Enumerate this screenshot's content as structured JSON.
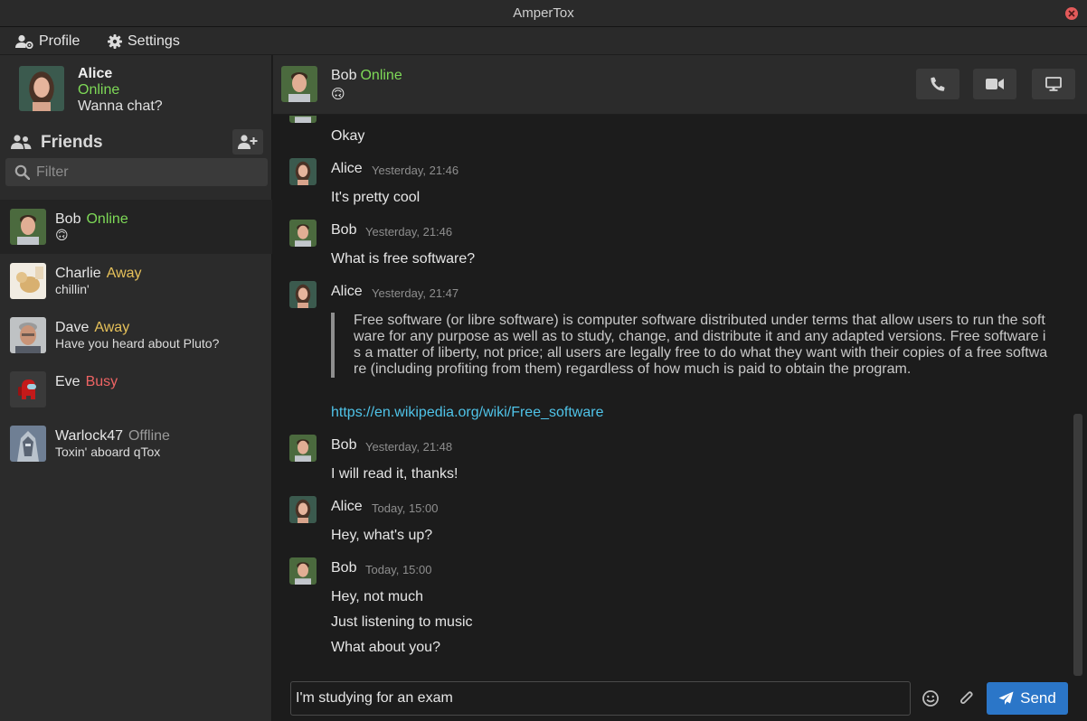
{
  "window": {
    "title": "AmperTox"
  },
  "menu": {
    "profile_label": "Profile",
    "settings_label": "Settings"
  },
  "self": {
    "name": "Alice",
    "status": "Online",
    "status_message": "Wanna chat?"
  },
  "friends_panel": {
    "title": "Friends",
    "filter_placeholder": "Filter"
  },
  "friends": [
    {
      "name": "Bob",
      "status": "Online",
      "message": "🙃"
    },
    {
      "name": "Charlie",
      "status": "Away",
      "message": "chillin'"
    },
    {
      "name": "Dave",
      "status": "Away",
      "message": "Have you heard about Pluto?"
    },
    {
      "name": "Eve",
      "status": "Busy",
      "message": ""
    },
    {
      "name": "Warlock47",
      "status": "Offline",
      "message": "Toxin' aboard qTox"
    }
  ],
  "chat": {
    "contact_name": "Bob",
    "contact_status": "Online",
    "contact_message": "🙃",
    "partial_first_line": "Okay",
    "messages": [
      {
        "author": "Alice",
        "time": "Yesterday, 21:46",
        "lines": [
          "It's pretty cool"
        ]
      },
      {
        "author": "Bob",
        "time": "Yesterday, 21:46",
        "lines": [
          "What is free software?"
        ]
      },
      {
        "author": "Alice",
        "time": "Yesterday, 21:47",
        "quote": "Free software (or libre software) is computer software distributed under terms that allow users to run the software for any purpose as well as to study, change, and distribute it and any adapted versions. Free software is a matter of liberty, not price; all users are legally free to do what they want with their copies of a free software (including profiting from them) regardless of how much is paid to obtain the program.",
        "link": "https://en.wikipedia.org/wiki/Free_software"
      },
      {
        "author": "Bob",
        "time": "Yesterday, 21:48",
        "lines": [
          "I will read it, thanks!"
        ]
      },
      {
        "author": "Alice",
        "time": "Today, 15:00",
        "lines": [
          "Hey, what's up?"
        ]
      },
      {
        "author": "Bob",
        "time": "Today, 15:00",
        "lines": [
          "Hey, not much",
          "Just listening to music",
          "What about you?"
        ]
      }
    ]
  },
  "compose": {
    "value": "I'm studying for an exam",
    "send_label": "Send"
  },
  "icons": {
    "profile": "user-gear-icon",
    "settings": "gear-icon",
    "friends": "people-icon",
    "add_friend": "add-user-icon",
    "search": "search-icon",
    "call": "phone-icon",
    "video": "video-camera-icon",
    "screen": "monitor-icon",
    "emoji": "smiley-icon",
    "attach": "paperclip-icon",
    "send": "paper-plane-icon",
    "close": "close-icon"
  },
  "colors": {
    "online": "#7ed957",
    "away": "#e6c15a",
    "busy": "#ee6464",
    "offline": "#9a9a9a",
    "accent": "#2b76c8",
    "link": "#4fc3e8"
  }
}
